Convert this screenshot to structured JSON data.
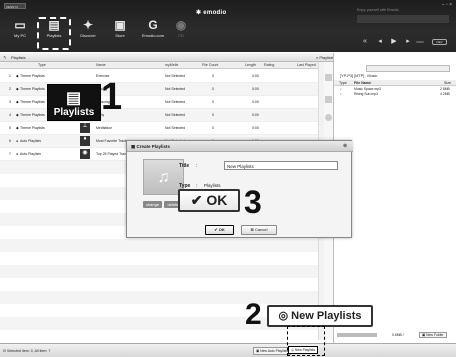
{
  "app": {
    "logo": "emodio",
    "brand": "Enjoy yourself with Emodio",
    "window_label": "KENNY/I"
  },
  "toolbar": [
    {
      "label": "My PC",
      "glyph": "▭"
    },
    {
      "label": "Playlists",
      "glyph": "▤"
    },
    {
      "label": "Discover",
      "glyph": "✦"
    },
    {
      "label": "Store",
      "glyph": "▣"
    },
    {
      "label": "Emodio.com",
      "glyph": "G"
    },
    {
      "label": "CD",
      "glyph": "◉"
    }
  ],
  "playback": {
    "prev": "«",
    "rew": "◂",
    "play": "▶",
    "fwd": "▸",
    "mode": "▭▭",
    "device": "DEV"
  },
  "left": {
    "tab": "Playlists",
    "columns": [
      "Type",
      "Name",
      "myMelle",
      "File Count",
      "Length",
      "Rating",
      "Last Played"
    ],
    "rows": [
      {
        "n": "1",
        "type": "Theme Playlists",
        "name": "Exercise",
        "melle": "Not Selected",
        "count": "0",
        "length": "0:00"
      },
      {
        "n": "2",
        "type": "Theme Playlists",
        "name": "Driving",
        "melle": "Not Selected",
        "count": "0",
        "length": "0:00"
      },
      {
        "n": "3",
        "type": "Theme Playlists",
        "name": "Relaxing",
        "melle": "Not Selected",
        "count": "0",
        "length": "0:00"
      },
      {
        "n": "4",
        "type": "Theme Playlists",
        "name": "Party",
        "melle": "Not Selected",
        "count": "0",
        "length": "0:00"
      },
      {
        "n": "5",
        "type": "Theme Playlists",
        "name": "Meditation",
        "melle": "Not Selected",
        "count": "0",
        "length": "0:00"
      },
      {
        "n": "6",
        "type": "Auto Playlists",
        "name": "Most Favorite Tracks",
        "melle": "Not Selected",
        "count": "0",
        "length": "0:00"
      },
      {
        "n": "7",
        "type": "Auto Playlists",
        "name": "Top 25 Played Tracks",
        "melle": "Not Selected",
        "count": "0",
        "length": "0:00"
      }
    ]
  },
  "right": {
    "tab": "Playlists",
    "device_path": "[YP-P3] [MTP] : Music",
    "columns": [
      "Type",
      "File Name",
      "Size"
    ],
    "files": [
      {
        "name": "Music Space.mp3",
        "size": "2.8MB"
      },
      {
        "name": "Rising Sun.mp3",
        "size": "4.2MB"
      }
    ],
    "capacity": "0.6MB /",
    "new_folder": "New Folder"
  },
  "dialog": {
    "title": "Create Playlists",
    "title_label": "Title",
    "title_value": "New Playlists",
    "type_label": "Type",
    "type_value": "Playlists",
    "change": "change",
    "delete": "delete",
    "ok": "OK",
    "cancel": "Cancel",
    "sep": ":"
  },
  "callouts": {
    "step1": "1",
    "step1_label": "Playlists",
    "step2": "2",
    "step2_label": "New Playlists",
    "step3": "3",
    "step3_label": "OK"
  },
  "status": {
    "selected": "Selected item: 0, All item: 7",
    "new_auto": "New Auto Playlists",
    "new_pl": "New Playlists"
  }
}
